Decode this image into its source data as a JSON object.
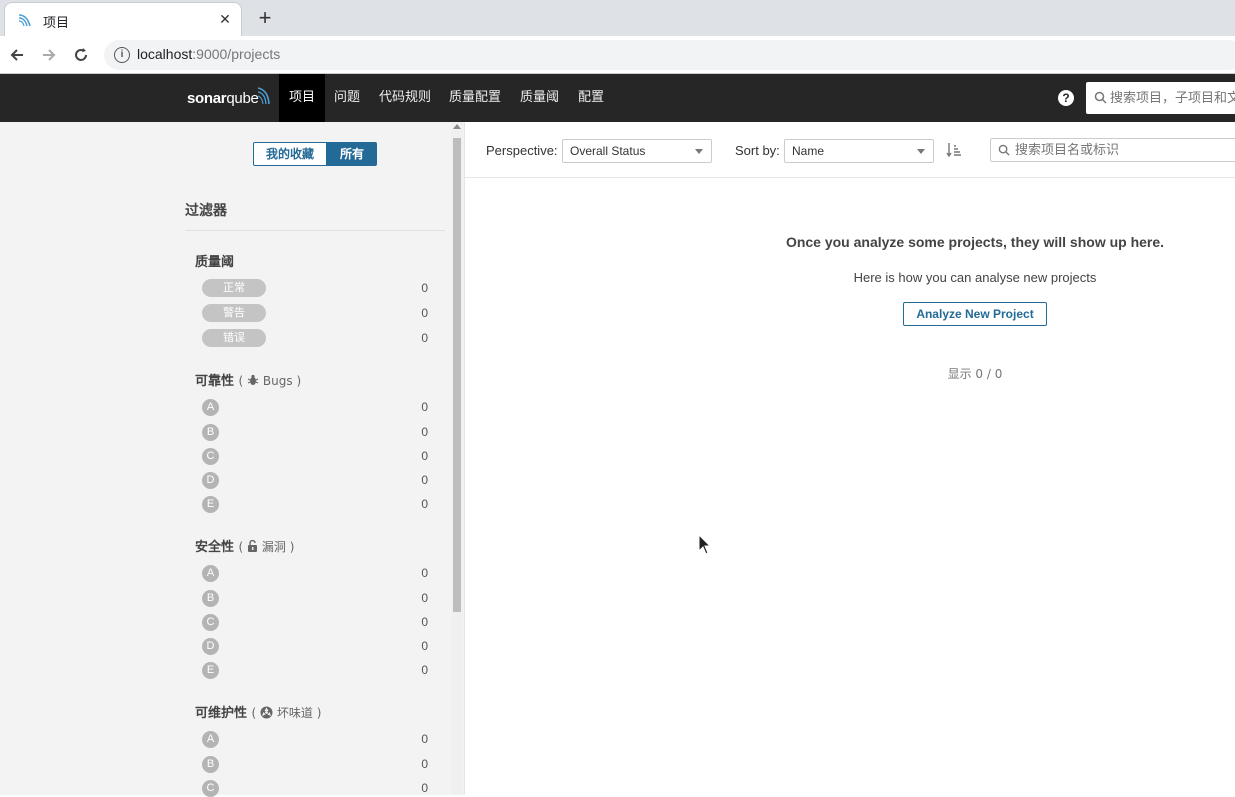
{
  "browser": {
    "tab_title": "项目",
    "close_glyph": "✕",
    "newtab_glyph": "+",
    "url_host": "localhost",
    "url_rest": ":9000/projects"
  },
  "navbar": {
    "logo_bold": "sonar",
    "logo_thin": "qube",
    "items": [
      "项目",
      "问题",
      "代码规则",
      "质量配置",
      "质量阈",
      "配置"
    ],
    "help_glyph": "?",
    "search_placeholder": "搜索项目，子项目和文件"
  },
  "sidebar": {
    "toggle_favorites": "我的收藏",
    "toggle_all": "所有",
    "filters_title": "过滤器",
    "quality_gate": {
      "title": "质量阈",
      "options": [
        {
          "label": "正常",
          "count": "0"
        },
        {
          "label": "警告",
          "count": "0"
        },
        {
          "label": "错误",
          "count": "0"
        }
      ]
    },
    "reliability": {
      "title": "可靠性",
      "sub": "Bugs",
      "paren_open": "(",
      "paren_close": ")",
      "icon": "bug-icon",
      "ratings": [
        {
          "label": "A",
          "count": "0"
        },
        {
          "label": "B",
          "count": "0"
        },
        {
          "label": "C",
          "count": "0"
        },
        {
          "label": "D",
          "count": "0"
        },
        {
          "label": "E",
          "count": "0"
        }
      ]
    },
    "security": {
      "title": "安全性",
      "sub": "漏洞",
      "paren_open": "(",
      "paren_close": ")",
      "icon": "lock-icon",
      "ratings": [
        {
          "label": "A",
          "count": "0"
        },
        {
          "label": "B",
          "count": "0"
        },
        {
          "label": "C",
          "count": "0"
        },
        {
          "label": "D",
          "count": "0"
        },
        {
          "label": "E",
          "count": "0"
        }
      ]
    },
    "maintainability": {
      "title": "可维护性",
      "sub": "坏味道",
      "paren_open": "(",
      "paren_close": ")",
      "icon": "code-smell-icon",
      "ratings": [
        {
          "label": "A",
          "count": "0"
        },
        {
          "label": "B",
          "count": "0"
        },
        {
          "label": "C",
          "count": "0"
        }
      ]
    }
  },
  "main": {
    "perspective_label": "Perspective:",
    "perspective_value": "Overall Status",
    "sort_label": "Sort by:",
    "sort_value": "Name",
    "search_placeholder": "搜索项目名或标识",
    "empty_title": "Once you analyze some projects, they will show up here.",
    "empty_sub": "Here is how you can analyse new projects",
    "analyze_button": "Analyze New Project",
    "paging": "显示 0 / 0"
  },
  "colors": {
    "navbar_bg": "#262626",
    "accent_blue": "#236a97",
    "sidebar_bg": "#f3f3f3",
    "rating_grey": "#b4b4b4"
  }
}
